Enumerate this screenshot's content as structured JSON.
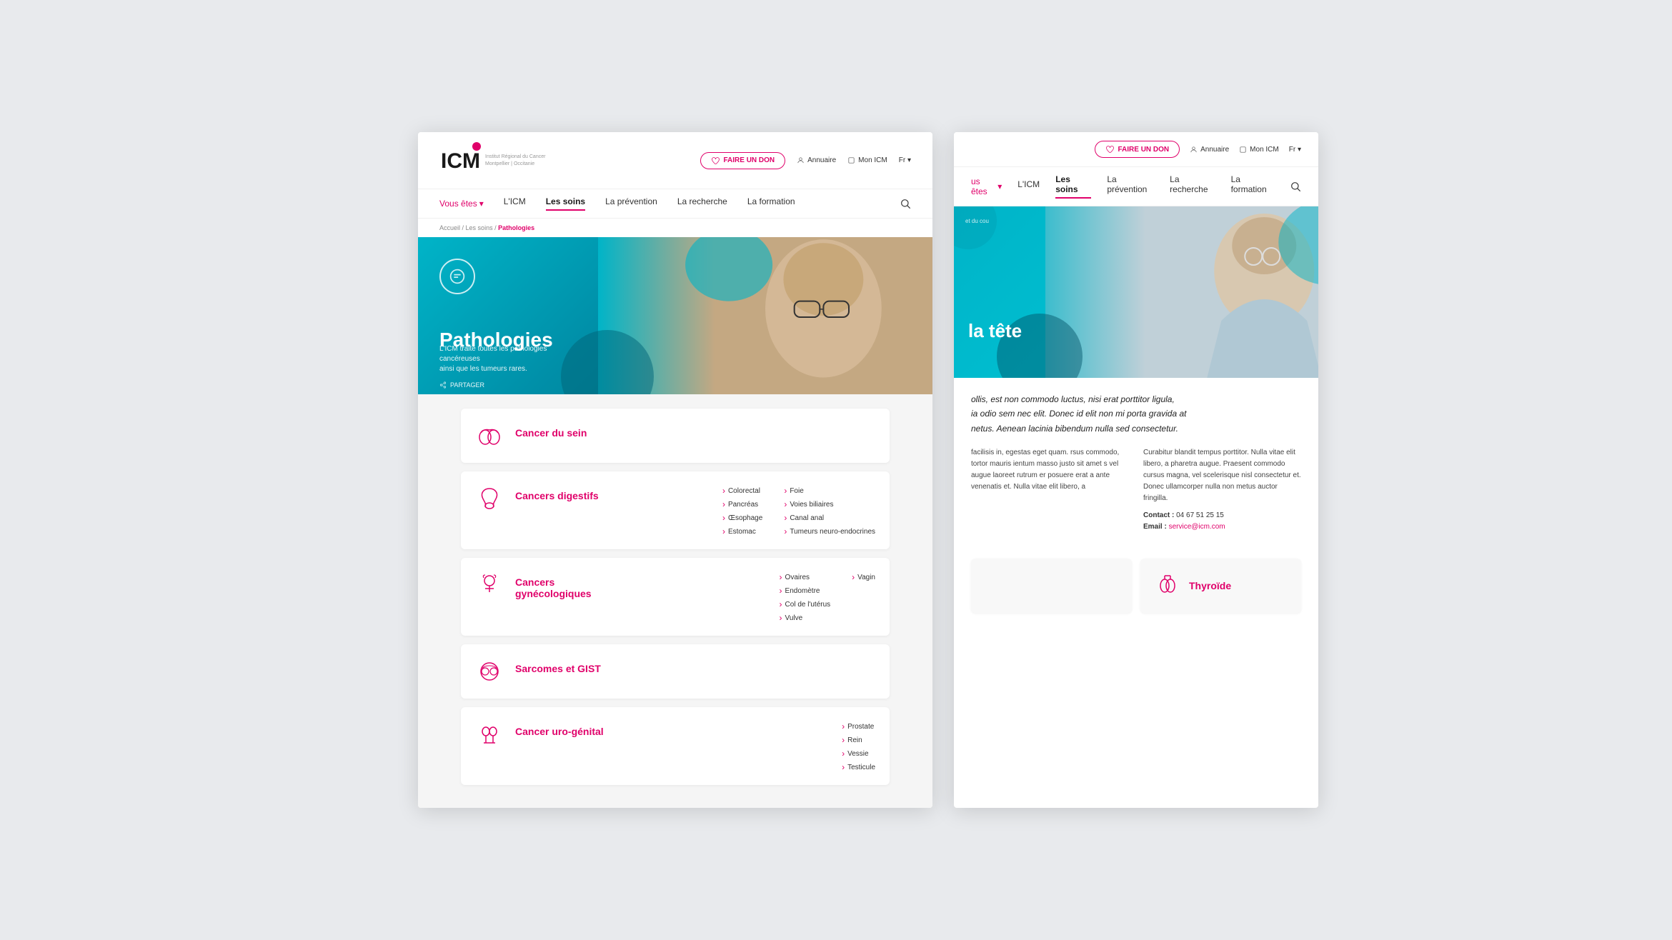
{
  "left_window": {
    "header": {
      "logo_text": "ICM",
      "logo_subtitle": "Institut Régional du Cancer\nMontpellier | Occitanie",
      "btn_faire_don": "FAIRE UN DON",
      "annuaire": "Annuaire",
      "mon_icm": "Mon ICM",
      "lang": "Fr"
    },
    "nav": {
      "vous_etes": "Vous êtes",
      "icm": "L'ICM",
      "les_soins": "Les soins",
      "la_prevention": "La prévention",
      "la_recherche": "La recherche",
      "la_formation": "La formation"
    },
    "breadcrumb": {
      "accueil": "Accueil",
      "les_soins": "Les soins",
      "current": "Pathologies"
    },
    "hero": {
      "title": "Pathologies",
      "subtitle": "L'ICM traite toutes les pathologies cancéreuses\nainsi que les tumeurs rares.",
      "share": "PARTAGER"
    },
    "pathologies": [
      {
        "name": "Cancer du sein",
        "icon": "breast-icon",
        "sub_links": []
      },
      {
        "name": "Cancers digestifs",
        "icon": "digestif-icon",
        "col1": [
          "Colorectal",
          "Pancréas",
          "Œsophage",
          "Estomac"
        ],
        "col2": [
          "Foie",
          "Voies biliaires",
          "Canal anal",
          "Tumeurs neuro-endocrines"
        ]
      },
      {
        "name": "Cancers\ngynécologiques",
        "icon": "gyneco-icon",
        "col1": [
          "Ovaires",
          "Endomètre",
          "Col de l'utérus",
          "Vulve"
        ],
        "col2": [
          "Vagin"
        ]
      },
      {
        "name": "Sarcomes et GIST",
        "icon": "sarcomes-icon",
        "col1": [],
        "col2": []
      },
      {
        "name": "Cancer uro-génital",
        "icon": "urogenital-icon",
        "col1": [
          "Prostate",
          "Rein",
          "Vessie",
          "Testicule"
        ],
        "col2": []
      }
    ]
  },
  "right_window": {
    "header": {
      "btn_faire_don": "FAIRE UN DON",
      "annuaire": "Annuaire",
      "mon_icm": "Mon ICM",
      "lang": "Fr"
    },
    "nav": {
      "vous_etes": "us êtes",
      "icm": "L'ICM",
      "les_soins": "Les soins",
      "la_prevention": "La prévention",
      "la_recherche": "La recherche",
      "la_formation": "La formation"
    },
    "hero": {
      "tag": "et du cou",
      "title": "la tête"
    },
    "article": {
      "main_text": "ollis, est non commodo luctus, nisi erat porttitor ligula,\nia odio sem nec elit. Donec id elit non mi porta gravida at\nnetus. Aenean lacinia bibendum nulla sed consectetur.",
      "col1_text": "facilisis in, egestas eget quam.\nrsus commodo, tortor mauris\nientum masso justo sit amet\ns vel augue laoreet rutrum\ner posuere erat a ante venenatis\net. Nulla vitae elit libero, a",
      "col2_text": "Curabitur blandit tempus porttitor. Nulla vitae elit libero, a\npharetra augue. Praesent commodo cursus magna, vel\nscelerisque nisl consectetur et. Donec ullamcorper nulla non\nmetus auctor fringilla.",
      "contact_label": "Contact :",
      "contact_phone": "04 67 51 25 15",
      "email_label": "Email :",
      "email": "service@icm.com"
    },
    "bottom_card": {
      "name": "Thyroïde",
      "icon": "thyroid-icon"
    }
  }
}
